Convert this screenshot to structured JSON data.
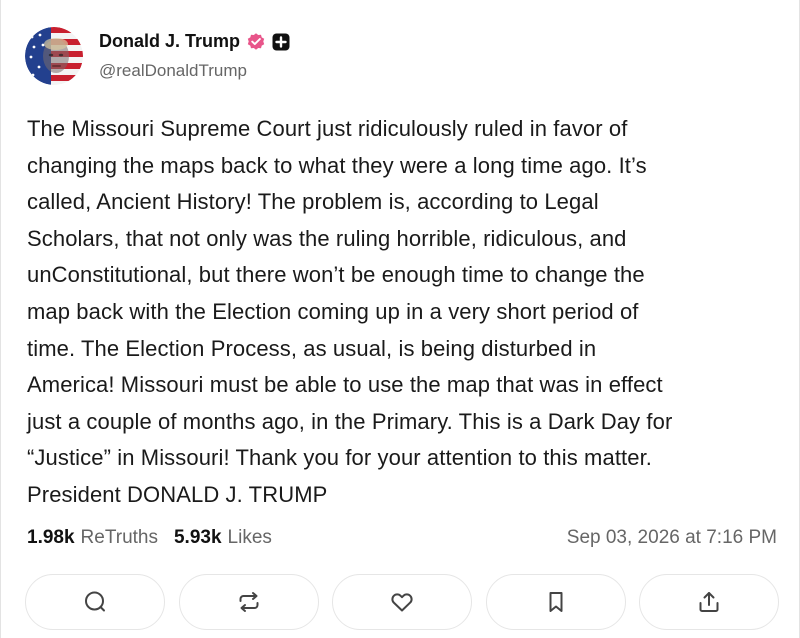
{
  "post": {
    "author": {
      "display_name": "Donald J. Trump",
      "handle": "@realDonaldTrump",
      "avatar_icon": "flag-portrait-avatar",
      "verified_icon": "verified-badge-icon",
      "verified_color": "#e8558a",
      "extra_badge_icon": "plus-badge-icon"
    },
    "body": "The Missouri Supreme Court just ridiculously ruled in favor of\nchanging the maps back to what they were a long time ago. It’s\ncalled, Ancient History! The problem is, according to Legal\nScholars, that not only was the ruling horrible, ridiculous, and\nunConstitutional, but there won’t be enough time to change the\nmap back with the Election coming up in a very short period of\ntime. The Election Process, as usual, is being disturbed in\nAmerica! Missouri must be able to use the map that was in effect\njust a couple of months ago, in the Primary. This is a Dark Day for\n“Justice” in Missouri! Thank you for your attention to this matter.\nPresident DONALD J. TRUMP",
    "stats": {
      "retruths_count": "1.98k",
      "retruths_label": "ReTruths",
      "likes_count": "5.93k",
      "likes_label": "Likes"
    },
    "timestamp": "Sep 03, 2026 at 7:16 PM",
    "actions": [
      {
        "name": "reply",
        "icon": "reply-icon"
      },
      {
        "name": "retruth",
        "icon": "retruth-icon"
      },
      {
        "name": "like",
        "icon": "heart-icon"
      },
      {
        "name": "bookmark",
        "icon": "bookmark-icon"
      },
      {
        "name": "share",
        "icon": "share-icon"
      }
    ]
  },
  "colors": {
    "text_primary": "#111111",
    "text_secondary": "#666666",
    "border": "#e6e6e6",
    "icon": "#444444"
  }
}
